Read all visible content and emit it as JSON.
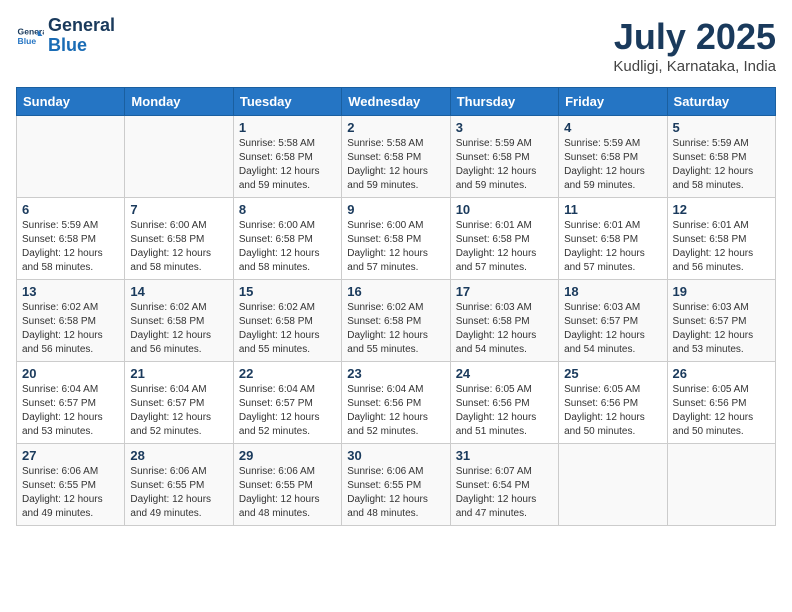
{
  "header": {
    "logo_line1": "General",
    "logo_line2": "Blue",
    "month": "July 2025",
    "location": "Kudligi, Karnataka, India"
  },
  "weekdays": [
    "Sunday",
    "Monday",
    "Tuesday",
    "Wednesday",
    "Thursday",
    "Friday",
    "Saturday"
  ],
  "weeks": [
    [
      {
        "day": "",
        "info": ""
      },
      {
        "day": "",
        "info": ""
      },
      {
        "day": "1",
        "sunrise": "5:58 AM",
        "sunset": "6:58 PM",
        "daylight": "12 hours and 59 minutes."
      },
      {
        "day": "2",
        "sunrise": "5:58 AM",
        "sunset": "6:58 PM",
        "daylight": "12 hours and 59 minutes."
      },
      {
        "day": "3",
        "sunrise": "5:59 AM",
        "sunset": "6:58 PM",
        "daylight": "12 hours and 59 minutes."
      },
      {
        "day": "4",
        "sunrise": "5:59 AM",
        "sunset": "6:58 PM",
        "daylight": "12 hours and 59 minutes."
      },
      {
        "day": "5",
        "sunrise": "5:59 AM",
        "sunset": "6:58 PM",
        "daylight": "12 hours and 58 minutes."
      }
    ],
    [
      {
        "day": "6",
        "sunrise": "5:59 AM",
        "sunset": "6:58 PM",
        "daylight": "12 hours and 58 minutes."
      },
      {
        "day": "7",
        "sunrise": "6:00 AM",
        "sunset": "6:58 PM",
        "daylight": "12 hours and 58 minutes."
      },
      {
        "day": "8",
        "sunrise": "6:00 AM",
        "sunset": "6:58 PM",
        "daylight": "12 hours and 58 minutes."
      },
      {
        "day": "9",
        "sunrise": "6:00 AM",
        "sunset": "6:58 PM",
        "daylight": "12 hours and 57 minutes."
      },
      {
        "day": "10",
        "sunrise": "6:01 AM",
        "sunset": "6:58 PM",
        "daylight": "12 hours and 57 minutes."
      },
      {
        "day": "11",
        "sunrise": "6:01 AM",
        "sunset": "6:58 PM",
        "daylight": "12 hours and 57 minutes."
      },
      {
        "day": "12",
        "sunrise": "6:01 AM",
        "sunset": "6:58 PM",
        "daylight": "12 hours and 56 minutes."
      }
    ],
    [
      {
        "day": "13",
        "sunrise": "6:02 AM",
        "sunset": "6:58 PM",
        "daylight": "12 hours and 56 minutes."
      },
      {
        "day": "14",
        "sunrise": "6:02 AM",
        "sunset": "6:58 PM",
        "daylight": "12 hours and 56 minutes."
      },
      {
        "day": "15",
        "sunrise": "6:02 AM",
        "sunset": "6:58 PM",
        "daylight": "12 hours and 55 minutes."
      },
      {
        "day": "16",
        "sunrise": "6:02 AM",
        "sunset": "6:58 PM",
        "daylight": "12 hours and 55 minutes."
      },
      {
        "day": "17",
        "sunrise": "6:03 AM",
        "sunset": "6:58 PM",
        "daylight": "12 hours and 54 minutes."
      },
      {
        "day": "18",
        "sunrise": "6:03 AM",
        "sunset": "6:57 PM",
        "daylight": "12 hours and 54 minutes."
      },
      {
        "day": "19",
        "sunrise": "6:03 AM",
        "sunset": "6:57 PM",
        "daylight": "12 hours and 53 minutes."
      }
    ],
    [
      {
        "day": "20",
        "sunrise": "6:04 AM",
        "sunset": "6:57 PM",
        "daylight": "12 hours and 53 minutes."
      },
      {
        "day": "21",
        "sunrise": "6:04 AM",
        "sunset": "6:57 PM",
        "daylight": "12 hours and 52 minutes."
      },
      {
        "day": "22",
        "sunrise": "6:04 AM",
        "sunset": "6:57 PM",
        "daylight": "12 hours and 52 minutes."
      },
      {
        "day": "23",
        "sunrise": "6:04 AM",
        "sunset": "6:56 PM",
        "daylight": "12 hours and 52 minutes."
      },
      {
        "day": "24",
        "sunrise": "6:05 AM",
        "sunset": "6:56 PM",
        "daylight": "12 hours and 51 minutes."
      },
      {
        "day": "25",
        "sunrise": "6:05 AM",
        "sunset": "6:56 PM",
        "daylight": "12 hours and 50 minutes."
      },
      {
        "day": "26",
        "sunrise": "6:05 AM",
        "sunset": "6:56 PM",
        "daylight": "12 hours and 50 minutes."
      }
    ],
    [
      {
        "day": "27",
        "sunrise": "6:06 AM",
        "sunset": "6:55 PM",
        "daylight": "12 hours and 49 minutes."
      },
      {
        "day": "28",
        "sunrise": "6:06 AM",
        "sunset": "6:55 PM",
        "daylight": "12 hours and 49 minutes."
      },
      {
        "day": "29",
        "sunrise": "6:06 AM",
        "sunset": "6:55 PM",
        "daylight": "12 hours and 48 minutes."
      },
      {
        "day": "30",
        "sunrise": "6:06 AM",
        "sunset": "6:55 PM",
        "daylight": "12 hours and 48 minutes."
      },
      {
        "day": "31",
        "sunrise": "6:07 AM",
        "sunset": "6:54 PM",
        "daylight": "12 hours and 47 minutes."
      },
      {
        "day": "",
        "info": ""
      },
      {
        "day": "",
        "info": ""
      }
    ]
  ]
}
